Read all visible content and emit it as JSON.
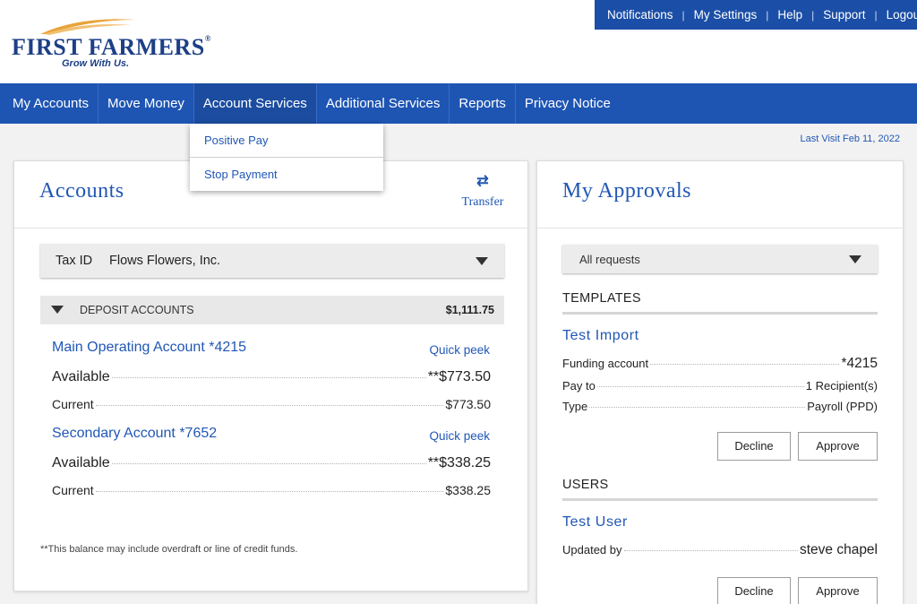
{
  "brand": {
    "name": "FIRST FARMERS",
    "tagline": "Grow With Us."
  },
  "utility_nav": [
    "Notifications",
    "My Settings",
    "Help",
    "Support",
    "Logout"
  ],
  "main_nav": [
    "My Accounts",
    "Move Money",
    "Account Services",
    "Additional Services",
    "Reports",
    "Privacy Notice"
  ],
  "dropdown": [
    "Positive Pay",
    "Stop Payment"
  ],
  "last_visit": "Last Visit Feb 11, 2022",
  "accounts_card": {
    "title": "Accounts",
    "transfer_label": "Transfer",
    "tax_id_label": "Tax ID",
    "tax_id_value": "Flows Flowers, Inc.",
    "section_name": "DEPOSIT ACCOUNTS",
    "section_total": "$1,111.75",
    "accounts": [
      {
        "name": "Main Operating Account  *4215",
        "quick_peek": "Quick peek",
        "available_label": "Available",
        "available_value": "**$773.50",
        "current_label": "Current",
        "current_value": "$773.50"
      },
      {
        "name": "Secondary Account  *7652",
        "quick_peek": "Quick peek",
        "available_label": "Available",
        "available_value": "**$338.25",
        "current_label": "Current",
        "current_value": "$338.25"
      }
    ],
    "footnote": "**This balance may include overdraft or line of credit funds."
  },
  "approvals_card": {
    "title": "My Approvals",
    "filter_value": "All requests",
    "templates": {
      "heading": "TEMPLATES",
      "item_title": "Test Import",
      "rows": [
        {
          "label": "Funding account",
          "value": "*4215"
        },
        {
          "label": "Pay to",
          "value": "1 Recipient(s)"
        },
        {
          "label": "Type",
          "value": "Payroll (PPD)"
        }
      ],
      "decline_label": "Decline",
      "approve_label": "Approve"
    },
    "users": {
      "heading": "USERS",
      "item_title": "Test User",
      "rows": [
        {
          "label": "Updated by",
          "value": "steve chapel"
        }
      ],
      "decline_label": "Decline",
      "approve_label": "Approve"
    }
  },
  "colors": {
    "nav_blue": "#1e55b3",
    "utility_blue": "#1b4ea6",
    "link_blue": "#2157b5",
    "brand_gold": "#e8a33a",
    "brand_navy": "#1c3f87"
  },
  "icons": [
    "transfer-icon",
    "chevron-down-icon",
    "collapse-triangle-icon"
  ]
}
